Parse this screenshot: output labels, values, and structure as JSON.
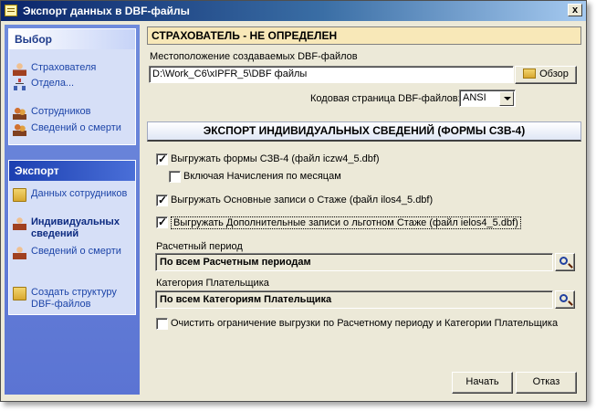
{
  "window": {
    "title": "Экспорт данных в DBF-файлы",
    "close_glyph": "x"
  },
  "sidebar": {
    "choose": {
      "title": "Выбор",
      "items": [
        {
          "label": "Страхователя",
          "icon": "person-icon"
        },
        {
          "label": "Отдела...",
          "icon": "org-chart-icon"
        },
        {
          "label": "Сотрудников",
          "icon": "group-icon"
        },
        {
          "label": "Сведений о смерти",
          "icon": "group-icon"
        }
      ]
    },
    "export": {
      "title": "Экспорт",
      "items": [
        {
          "label": "Данных сотрудников",
          "icon": "folder-icon"
        },
        {
          "label": "Индивидуальных сведений",
          "icon": "person-icon",
          "active": true
        },
        {
          "label": "Сведений о смерти",
          "icon": "person-icon"
        },
        {
          "label": "Создать структуру DBF-файлов",
          "icon": "folder-icon"
        }
      ]
    }
  },
  "main": {
    "insurer_banner": "СТРАХОВАТЕЛЬ - НЕ ОПРЕДЕЛЕН",
    "location_label": "Местоположение создаваемых DBF-файлов",
    "location_value": "D:\\Work_C6\\xIPFR_5\\DBF файлы",
    "browse_label": "Обзор",
    "codepage_label": "Кодовая страница DBF-файлов:",
    "codepage_value": "ANSI",
    "section_title": "ЭКСПОРТ ИНДИВИДУАЛЬНЫХ СВЕДЕНИЙ (ФОРМЫ СЗВ-4)",
    "checkboxes": [
      {
        "label": "Выгружать формы СЗВ-4 (файл iczw4_5.dbf)",
        "checked": true
      },
      {
        "label": "Включая Начисления по месяцам",
        "checked": false
      },
      {
        "label": "Выгружать Основные записи о Стаже (файл ilos4_5.dbf)",
        "checked": true
      },
      {
        "label": "Выгружать Дополнительные записи о льготном Стаже (файл ielos4_5.dbf)",
        "checked": true
      }
    ],
    "period_label": "Расчетный период",
    "period_value": "По всем Расчетным периодам",
    "category_label": "Категория Плательщика",
    "category_value": "По всем Категориям Плательщика",
    "clear_limit_label": "Очистить ограничение выгрузки по Расчетному периоду и Категории Плательщика",
    "clear_limit_checked": false
  },
  "footer": {
    "start_label": "Начать",
    "cancel_label": "Отказ"
  }
}
